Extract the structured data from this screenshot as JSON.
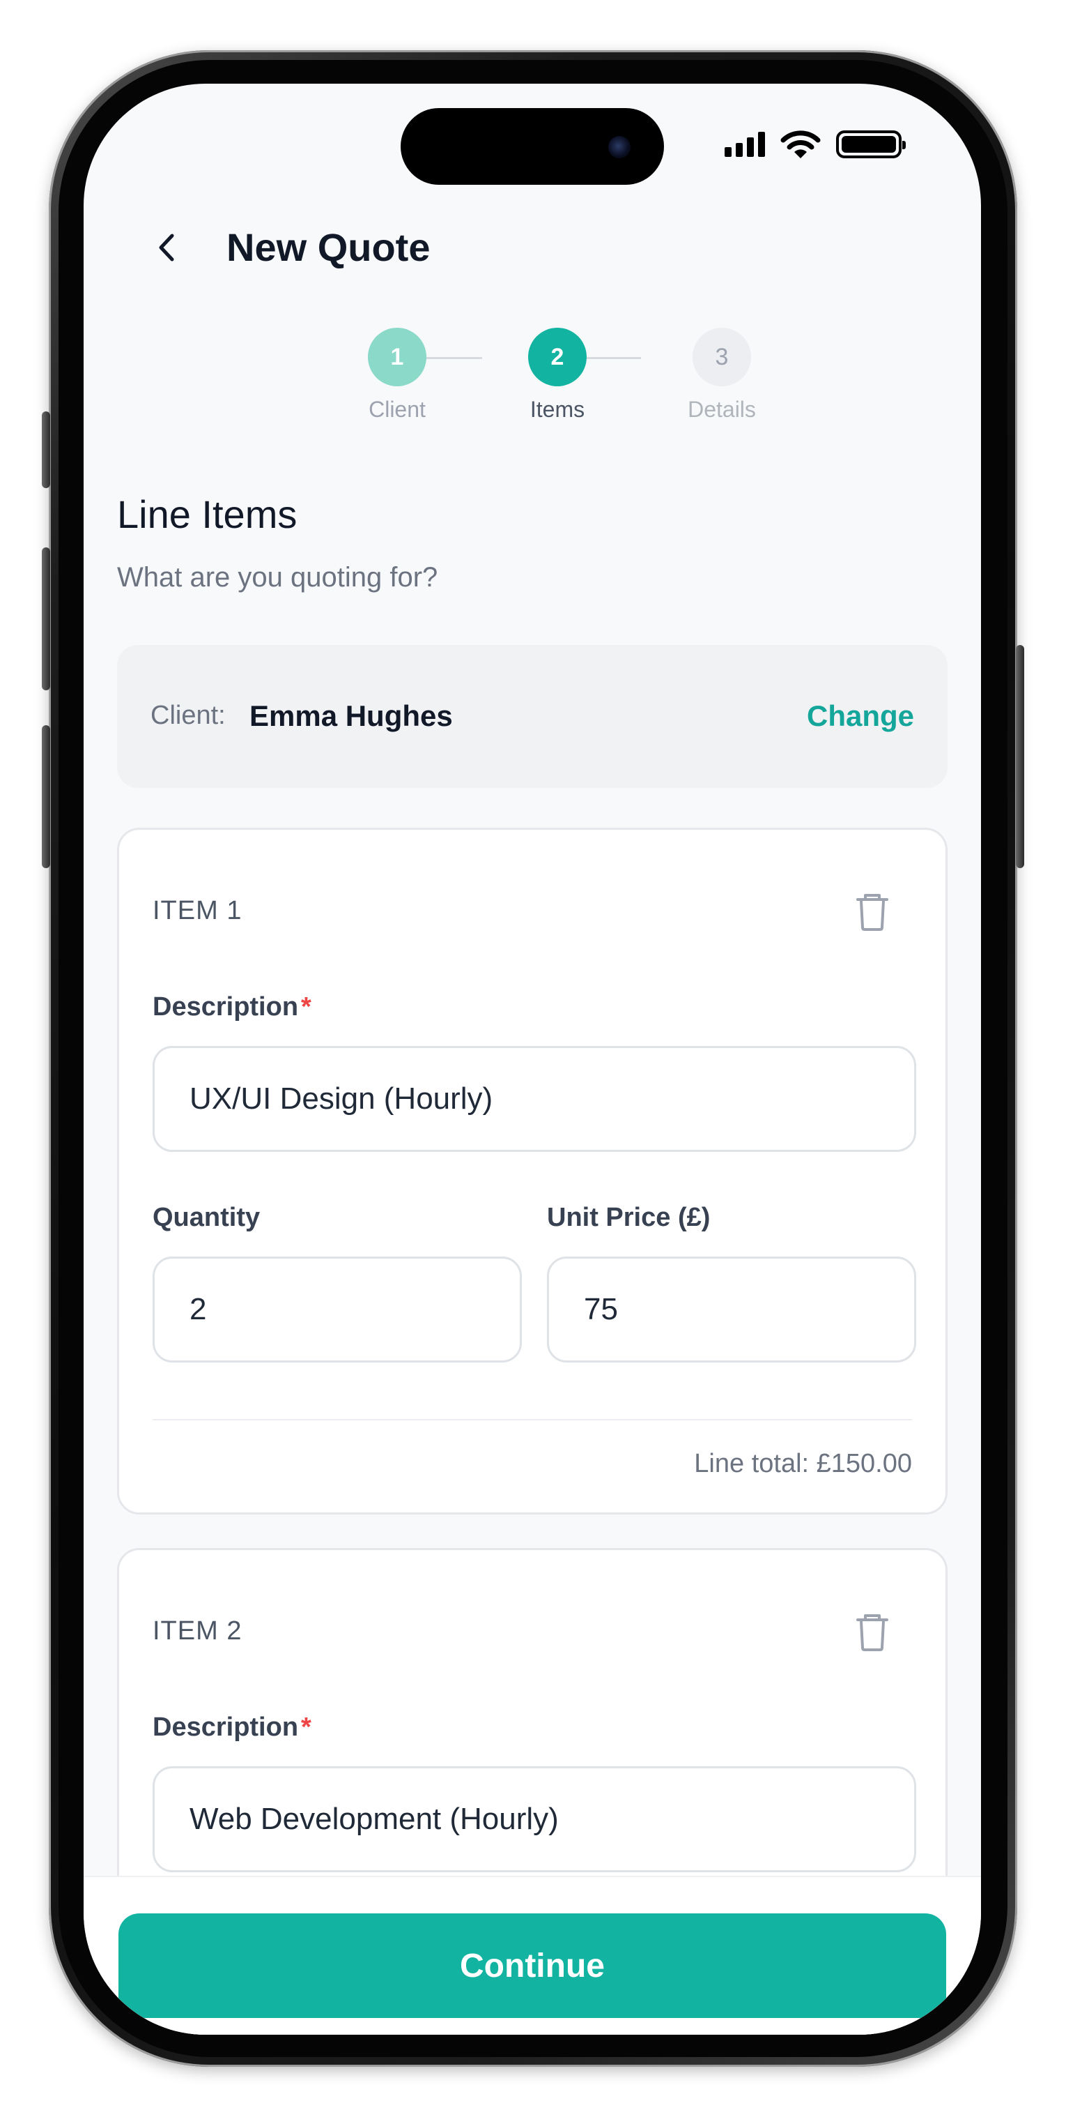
{
  "header": {
    "title": "New Quote",
    "back_icon": "chevron-left-icon"
  },
  "stepper": {
    "steps": [
      {
        "number": "1",
        "label": "Client",
        "state": "completed"
      },
      {
        "number": "2",
        "label": "Items",
        "state": "active"
      },
      {
        "number": "3",
        "label": "Details",
        "state": "upcoming"
      }
    ]
  },
  "section": {
    "title": "Line Items",
    "subtitle": "What are you quoting for?"
  },
  "client": {
    "label": "Client:",
    "name": "Emma Hughes",
    "change_label": "Change"
  },
  "items": [
    {
      "title": "ITEM 1",
      "description_label": "Description",
      "required_mark": "*",
      "description_value": "UX/UI Design (Hourly)",
      "quantity_label": "Quantity",
      "quantity_value": "2",
      "unit_price_label": "Unit Price (£)",
      "unit_price_value": "75",
      "line_total": "Line total: £150.00"
    },
    {
      "title": "ITEM 2",
      "description_label": "Description",
      "required_mark": "*",
      "description_value": "Web Development (Hourly)"
    }
  ],
  "footer": {
    "continue_label": "Continue"
  },
  "colors": {
    "accent": "#13b3a1",
    "accent_light": "#8ad9c9",
    "required": "#ef4444",
    "background": "#f8f9fb"
  }
}
